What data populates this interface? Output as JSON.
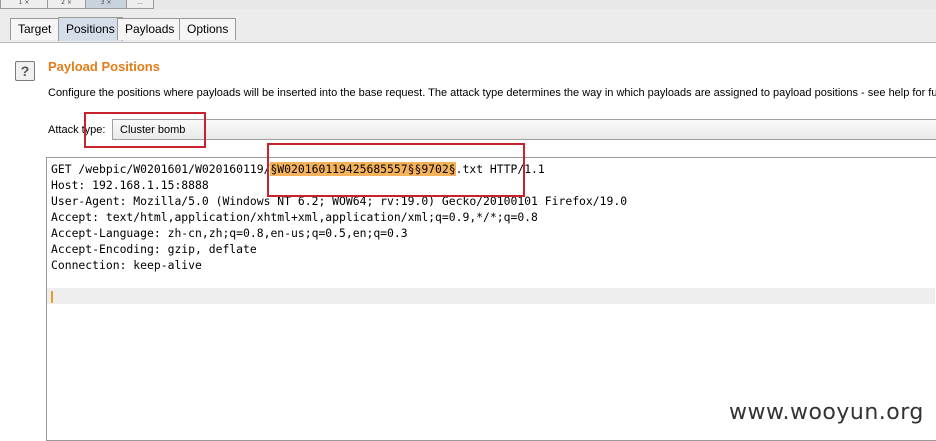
{
  "top_tabs": [
    "1 ×",
    "2 ×",
    "3 ×",
    "..."
  ],
  "sub_tabs": [
    {
      "label": "Target",
      "active": false
    },
    {
      "label": "Positions",
      "active": true
    },
    {
      "label": "Payloads",
      "active": false
    },
    {
      "label": "Options",
      "active": false
    }
  ],
  "panel": {
    "help_glyph": "?",
    "title": "Payload Positions",
    "description": "Configure the positions where payloads will be inserted into the base request. The attack type determines the way in which payloads are assigned to payload positions - see help for fu",
    "attack_type_label": "Attack type:",
    "attack_type_value": "Cluster bomb"
  },
  "request": {
    "line1_prefix": "GET /webpic/W0201601/W020160119/",
    "line1_highlight": "§W020160119425685557§§9702§",
    "line1_suffix": ".txt HTTP/1.1",
    "lines": [
      "Host: 192.168.1.15:8888",
      "User-Agent: Mozilla/5.0 (Windows NT 6.2; WOW64; rv:19.0) Gecko/20100101 Firefox/19.0",
      "Accept: text/html,application/xhtml+xml,application/xml;q=0.9,*/*;q=0.8",
      "Accept-Language: zh-cn,zh;q=0.8,en-us;q=0.5,en;q=0.3",
      "Accept-Encoding: gzip, deflate",
      "Connection: keep-alive"
    ]
  },
  "watermark": "www.wooyun.org",
  "colors": {
    "title": "#e57c18",
    "highlight": "#f4b35a",
    "annotation": "#c8232c"
  }
}
